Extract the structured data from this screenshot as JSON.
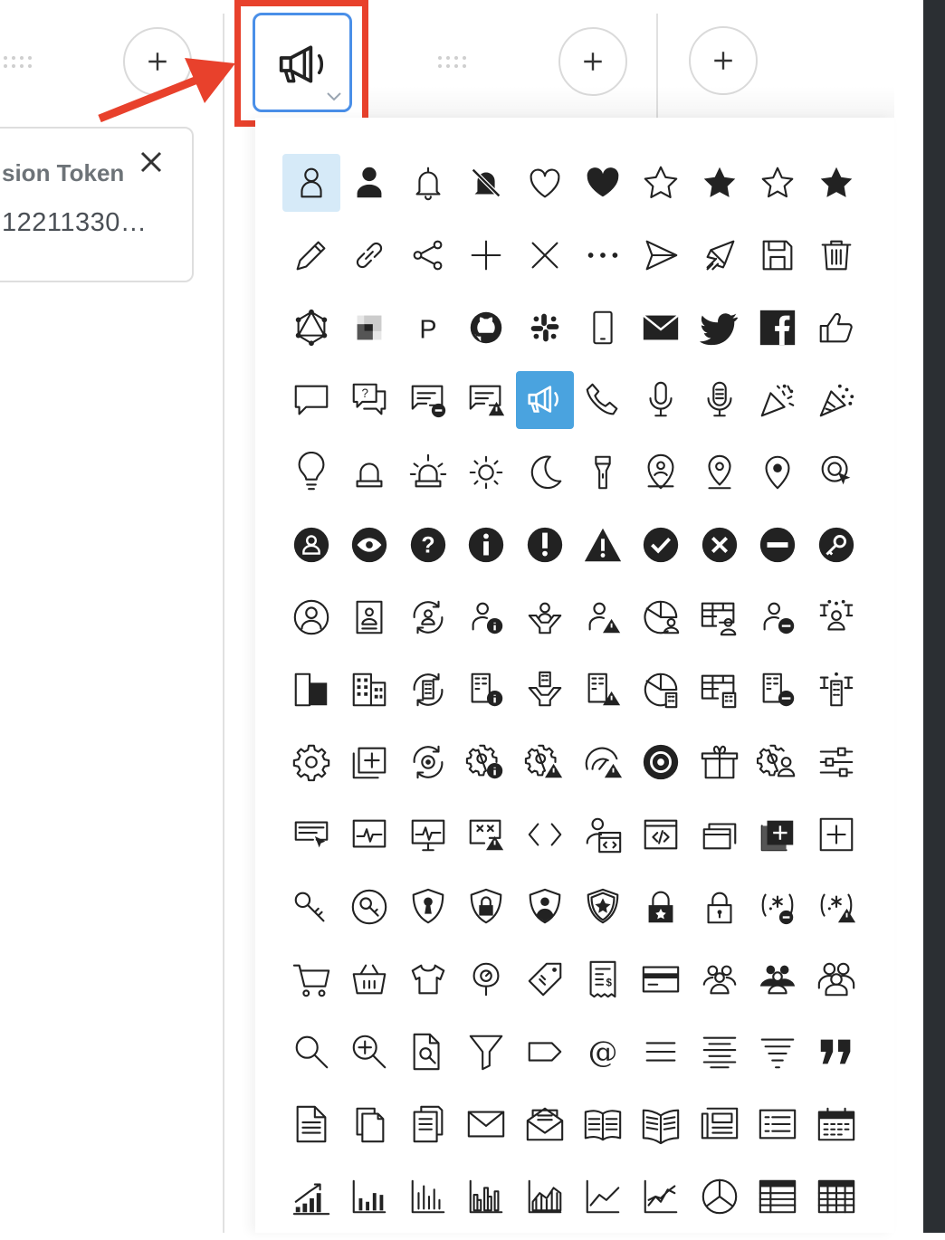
{
  "token_card": {
    "title": "sion Token",
    "value": "12211330…"
  },
  "picker": {
    "selected_icon": "megaphone-icon",
    "highlighted_icon": "user-outline-icon",
    "icons": [
      "user-outline-icon",
      "user-solid-icon",
      "bell-icon",
      "bell-slash-icon",
      "heart-outline-icon",
      "heart-solid-icon",
      "star-outline-icon",
      "star-solid-icon",
      "star-outline-alt-icon",
      "star-solid-alt-icon",
      "pencil-icon",
      "link-icon",
      "share-icon",
      "plus-icon",
      "close-icon",
      "ellipsis-icon",
      "send-icon",
      "rocket-icon",
      "save-icon",
      "trash-icon",
      "graphql-icon",
      "squares-logo-icon",
      "p-logo-icon",
      "github-icon",
      "slack-icon",
      "mobile-icon",
      "envelope-icon",
      "twitter-icon",
      "facebook-icon",
      "thumbs-up-icon",
      "comment-icon",
      "comment-question-icon",
      "message-minus-icon",
      "message-warning-icon",
      "megaphone-icon",
      "phone-icon",
      "microphone-icon",
      "podcast-mic-icon",
      "party-popper-icon",
      "party-popper-alt-icon",
      "lightbulb-icon",
      "alarm-bell-icon",
      "siren-icon",
      "sun-icon",
      "moon-icon",
      "flashlight-icon",
      "location-user-icon",
      "location-outline-icon",
      "location-solid-icon",
      "location-click-icon",
      "user-circle-solid-icon",
      "eye-circle-icon",
      "question-circle-icon",
      "info-circle-icon",
      "exclamation-circle-icon",
      "warning-triangle-icon",
      "check-circle-icon",
      "times-circle-icon",
      "minus-circle-icon",
      "key-circle-icon",
      "user-circle-outline-icon",
      "user-badge-icon",
      "user-sync-icon",
      "user-info-icon",
      "user-funnel-icon",
      "user-warning-icon",
      "user-chart-icon",
      "user-table-icon",
      "user-minus-icon",
      "user-network-icon",
      "building-icon",
      "buildings-icon",
      "building-sync-icon",
      "building-info-icon",
      "building-funnel-icon",
      "building-warning-icon",
      "building-chart-icon",
      "building-table-icon",
      "building-minus-icon",
      "building-network-icon",
      "gear-icon",
      "window-add-icon",
      "gear-sync-icon",
      "gear-info-icon",
      "gear-warning-icon",
      "gauge-warning-icon",
      "gear-circle-icon",
      "package-open-icon",
      "gear-user-icon",
      "sliders-icon",
      "form-cursor-icon",
      "monitor-pulse-icon",
      "desktop-pulse-icon",
      "screen-warning-icon",
      "code-icon",
      "user-code-icon",
      "code-window-icon",
      "windows-stack-icon",
      "window-add-solid-icon",
      "square-plus-icon",
      "key-icon",
      "key-circle-outline-icon",
      "shield-keyhole-icon",
      "shield-lock-icon",
      "shield-user-icon",
      "shield-star-icon",
      "lock-star-icon",
      "lock-icon",
      "password-minus-icon",
      "password-warning-icon",
      "cart-icon",
      "basket-icon",
      "shirt-icon",
      "parking-meter-icon",
      "price-tag-icon",
      "invoice-icon",
      "credit-card-icon",
      "users-icon",
      "users-solid-icon",
      "users-group-icon",
      "search-icon",
      "zoom-in-icon",
      "file-search-icon",
      "filter-icon",
      "label-icon",
      "at-icon",
      "align-justify-icon",
      "align-center-icon",
      "filter-lines-icon",
      "quote-icon",
      "document-icon",
      "copy-icon",
      "documents-icon",
      "mail-icon",
      "mail-open-icon",
      "book-open-icon",
      "book-lines-icon",
      "newspaper-icon",
      "list-icon",
      "calendar-icon",
      "chart-growth-icon",
      "bar-chart-icon",
      "bar-chart-alt-icon",
      "bar-chart-grouped-icon",
      "area-chart-icon",
      "line-chart-icon",
      "line-chart-multi-icon",
      "pie-chart-icon",
      "table-icon",
      "table-grid-icon"
    ]
  }
}
